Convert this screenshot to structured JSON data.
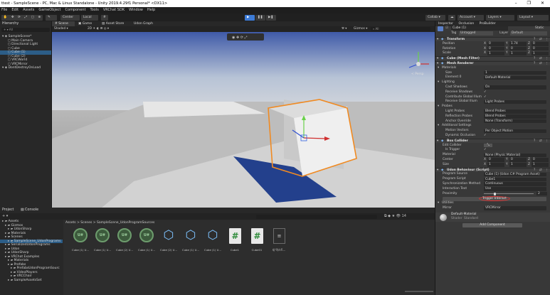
{
  "window": {
    "title": "ttest - SampleScene - PC, Mac & Linux Standalone - Unity 2019.4.29f1 Personal* <DX11>",
    "controls": [
      "–",
      "❐",
      "✕"
    ]
  },
  "menubar": [
    "File",
    "Edit",
    "Assets",
    "GameObject",
    "Component",
    "Tools",
    "VRChat SDK",
    "Window",
    "Help"
  ],
  "toolbar": {
    "pivot": "Center",
    "space": "Local",
    "collab": "Collab",
    "account": "Account",
    "layers": "Layers",
    "layout": "Layout"
  },
  "hierarchy": {
    "tab": "Hierarchy",
    "search_placeholder": "All",
    "items": [
      {
        "label": "SampleScene*",
        "indent": 0
      },
      {
        "label": "Main Camera",
        "indent": 2
      },
      {
        "label": "Directional Light",
        "indent": 2
      },
      {
        "label": "Cube",
        "indent": 2
      },
      {
        "label": "Cube (1)",
        "indent": 2
      },
      {
        "label": "Cube (2)",
        "indent": 2
      },
      {
        "label": "VRCWorld",
        "indent": 2
      },
      {
        "label": "VRCMirror",
        "indent": 2
      },
      {
        "label": "DontDestroyOnLoad",
        "indent": 0
      }
    ]
  },
  "scene": {
    "tabs": [
      "Scene",
      "Game",
      "Asset Store",
      "Udon Graph"
    ],
    "shading": "Shaded",
    "mode": "2D",
    "gizmos": "Gizmos",
    "search": "All",
    "persp": "< Persp"
  },
  "inspector": {
    "tabs": [
      "Inspector",
      "Occlusion",
      "ProBuilder"
    ],
    "object_name": "Cube (1)",
    "static_label": "Static",
    "tag_label": "Tag",
    "tag_value": "Untagged",
    "layer_label": "Layer",
    "layer_value": "Default",
    "transform": {
      "title": "Transform",
      "position": {
        "label": "Position",
        "x": "0",
        "y": "1.74",
        "z": "0"
      },
      "rotation": {
        "label": "Rotation",
        "x": "0",
        "y": "0",
        "z": "0"
      },
      "scale": {
        "label": "Scale",
        "x": "1",
        "y": "1",
        "z": "1"
      }
    },
    "mesh_filter": {
      "title": "Cube (Mesh Filter)"
    },
    "mesh_renderer": {
      "title": "Mesh Renderer",
      "materials": "Materials",
      "size_label": "Size",
      "size": "1",
      "element0_label": "Element 0",
      "element0": "Default-Material",
      "lighting": "Lighting",
      "cast_shadows_label": "Cast Shadows",
      "cast_shadows": "On",
      "receive_shadows_label": "Receive Shadows",
      "contribute_gi_label": "Contribute Global Illum",
      "receive_gi_label": "Receive Global Illum",
      "receive_gi": "Light Probes",
      "probes": "Probes",
      "light_probes_label": "Light Probes",
      "light_probes": "Blend Probes",
      "reflection_probes_label": "Reflection Probes",
      "reflection_probes": "Blend Probes",
      "anchor_override_label": "Anchor Override",
      "anchor_override": "None (Transform)",
      "additional": "Additional Settings",
      "motion_vectors_label": "Motion Vectors",
      "motion_vectors": "Per Object Motion",
      "dynamic_occlusion_label": "Dynamic Occlusion"
    },
    "box_collider": {
      "title": "Box Collider",
      "edit_label": "Edit Collider",
      "is_trigger_label": "Is Trigger",
      "material_label": "Material",
      "material": "None (Physic Material)",
      "center": {
        "label": "Center",
        "x": "0",
        "y": "0",
        "z": "0"
      },
      "size": {
        "label": "Size",
        "x": "1",
        "y": "1",
        "z": "1"
      }
    },
    "udon": {
      "title": "Udon Behaviour (Script)",
      "program_source_label": "Program Source",
      "program_source": "Cube (1) (Udon C# Program Asset)",
      "program_script_label": "Program Script",
      "program_script": "Cube1",
      "sync_label": "Synchronization Method",
      "sync": "Continuous",
      "interaction_text_label": "Interaction Text",
      "interaction_text": "Use",
      "proximity_label": "Proximity",
      "proximity": "2",
      "trigger_button": "Trigger Interact"
    },
    "utilities": "Utilities",
    "mirror_label": "Mirror",
    "mirror_value": "VRCMirror",
    "material_name": "Default-Material",
    "shader_label": "Shader",
    "shader_value": "Standard",
    "add_component": "Add Component"
  },
  "project": {
    "tabs": [
      "Project",
      "Console"
    ],
    "breadcrumb": "Assets > Scenes > SampleScene_UdonProgramSources",
    "tree": [
      {
        "label": "Assets",
        "indent": 0
      },
      {
        "label": "Gizmos",
        "indent": 1
      },
      {
        "label": "UdonSharp",
        "indent": 2
      },
      {
        "label": "Materials",
        "indent": 1
      },
      {
        "label": "Scenes",
        "indent": 1
      },
      {
        "label": "SampleScene_UdonPrograms",
        "indent": 2
      },
      {
        "label": "SerializedUdonPrograms",
        "indent": 1
      },
      {
        "label": "Udon",
        "indent": 1
      },
      {
        "label": "UdonSharp",
        "indent": 1
      },
      {
        "label": "VRChat Examples",
        "indent": 1
      },
      {
        "label": "Materials",
        "indent": 2
      },
      {
        "label": "Prefabs",
        "indent": 2
      },
      {
        "label": "PrefabsUdonProgramSourc",
        "indent": 3
      },
      {
        "label": "VideoPlayers",
        "indent": 3
      },
      {
        "label": "VRCChair",
        "indent": 3
      },
      {
        "label": "SampleAssetsSet",
        "indent": 2
      }
    ],
    "files": [
      {
        "label": "Cube (1) U...",
        "kind": "udon"
      },
      {
        "label": "Cube (1) U...",
        "kind": "udon"
      },
      {
        "label": "Cube (2) U...",
        "kind": "udon"
      },
      {
        "label": "Cube (1) U...",
        "kind": "udon"
      },
      {
        "label": "Cube (2) U...",
        "kind": "prefab"
      },
      {
        "label": "Cube (1) U...",
        "kind": "prefab"
      },
      {
        "label": "Cube (1) U...",
        "kind": "prefab"
      },
      {
        "label": "Cube1",
        "kind": "cs"
      },
      {
        "label": "Cube01",
        "kind": "cs"
      },
      {
        "label": "새 텍스트...",
        "kind": "txt"
      }
    ]
  }
}
